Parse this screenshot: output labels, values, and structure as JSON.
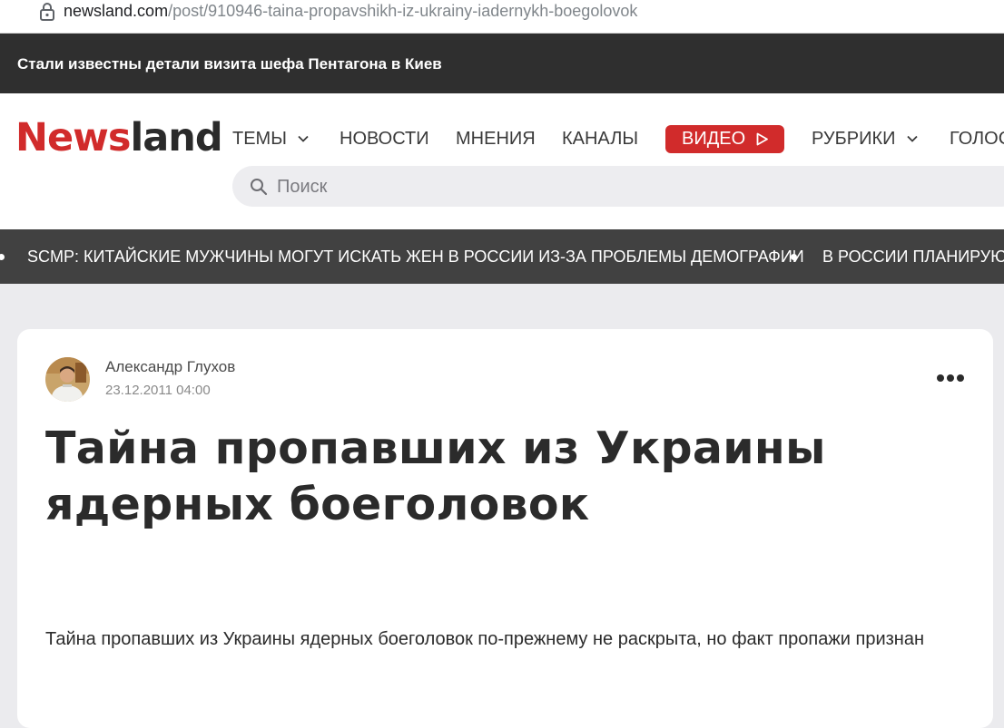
{
  "browser": {
    "url_host": "newsland.com",
    "url_path": "/post/910946-taina-propavshikh-iz-ukrainy-iadernykh-boegolovok"
  },
  "promo": {
    "text": "Стали известны детали визита шефа Пентагона в Киев"
  },
  "header": {
    "logo_part1": "News",
    "logo_part2": "land",
    "logo_color": "#d12b2b",
    "nav": {
      "themes": "ТЕМЫ",
      "news": "НОВОСТИ",
      "opinions": "МНЕНИЯ",
      "channels": "КАНАЛЫ",
      "video": "ВИДЕО",
      "rubrics": "РУБРИКИ",
      "votes": "ГОЛОС"
    },
    "search_placeholder": "Поиск"
  },
  "ticker": {
    "items": [
      "SCMP: КИТАЙСКИЕ МУЖЧИНЫ МОГУТ ИСКАТЬ ЖЕН В РОССИИ ИЗ-ЗА ПРОБЛЕМЫ ДЕМОГРАФИИ",
      "В РОССИИ ПЛАНИРУЮТ"
    ]
  },
  "article": {
    "author": "Александр Глухов",
    "date": "23.12.2011 04:00",
    "title": "Тайна пропавших из Украины ядерных боеголовок",
    "lead": "Тайна пропавших из Украины ядерных боеголовок по-прежнему не раскрыта, но факт пропажи признан"
  }
}
